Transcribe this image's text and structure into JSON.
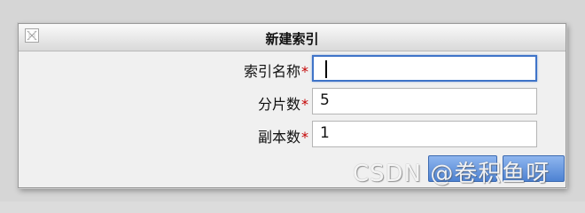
{
  "dialog": {
    "title": "新建索引",
    "fields": [
      {
        "label": "索引名称",
        "required_mark": "*",
        "value": ""
      },
      {
        "label": "分片数",
        "required_mark": "*",
        "value": "5"
      },
      {
        "label": "副本数",
        "required_mark": "*",
        "value": "1"
      }
    ],
    "title_icon": "window-icon"
  },
  "watermark": {
    "text": "CSDN @卷积鱼呀"
  },
  "colors": {
    "dialog_bg": "#f0f0f0",
    "required": "#c40000",
    "focus_border": "#3f74c8",
    "button": "#4d82d2"
  }
}
